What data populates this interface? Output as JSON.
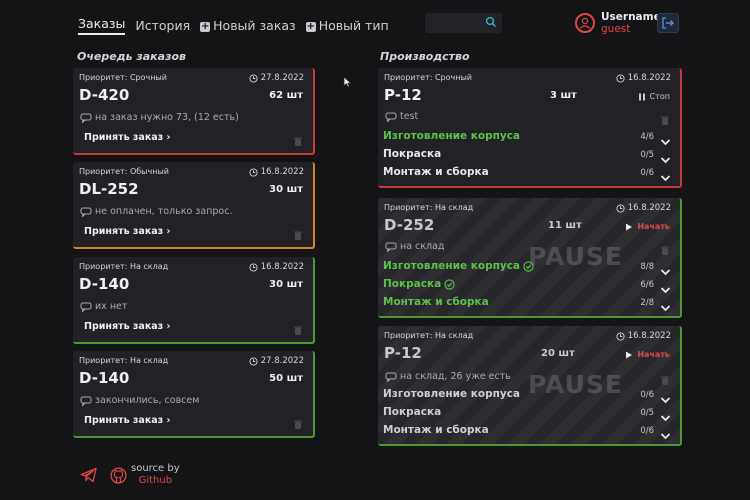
{
  "nav": {
    "tabs": [
      {
        "label": "Заказы"
      },
      {
        "label": "История"
      },
      {
        "label": "Новый заказ"
      },
      {
        "label": "Новый тип"
      }
    ]
  },
  "search": {
    "value": ""
  },
  "user": {
    "name": "Username",
    "role": "guest"
  },
  "queue": {
    "title": "Очередь заказов",
    "accept_label": "Принять заказ",
    "orders": [
      {
        "priority": "Приоритет: Срочный",
        "date": "27.8.2022",
        "code": "D-420",
        "qty": "62 шт",
        "note": "на заказ нужно 73, (12 есть)",
        "status": "red"
      },
      {
        "priority": "Приоритет: Обычный",
        "date": "16.8.2022",
        "code": "DL-252",
        "qty": "30 шт",
        "note": "не оплачен, только запрос.",
        "status": "orange"
      },
      {
        "priority": "Приоритет: На склад",
        "date": "16.8.2022",
        "code": "D-140",
        "qty": "30 шт",
        "note": "их нет",
        "status": "green"
      },
      {
        "priority": "Приоритет: На склад",
        "date": "27.8.2022",
        "code": "D-140",
        "qty": "50 шт",
        "note": "закончились, совсем",
        "status": "green"
      }
    ]
  },
  "production": {
    "title": "Производство",
    "pause_label": "PAUSE",
    "items": [
      {
        "priority": "Приоритет: Срочный",
        "date": "16.8.2022",
        "code": "P-12",
        "qty": "3 шт",
        "action": "Стоп",
        "note": "test",
        "paused": false,
        "status": "red",
        "stages": [
          {
            "name": "Изготовление корпуса",
            "count": "4/6",
            "done": true
          },
          {
            "name": "Покраска",
            "count": "0/5",
            "done": false
          },
          {
            "name": "Монтаж и сборка",
            "count": "0/6",
            "done": false
          }
        ]
      },
      {
        "priority": "Приоритет: На склад",
        "date": "16.8.2022",
        "code": "D-252",
        "qty": "11 шт",
        "action": "Начать",
        "note": "на склад",
        "paused": true,
        "status": "green",
        "stages": [
          {
            "name": "Изготовление корпуса",
            "count": "8/8",
            "done": true
          },
          {
            "name": "Покраска",
            "count": "6/6",
            "done": true
          },
          {
            "name": "Монтаж и сборка",
            "count": "2/8",
            "done": true
          }
        ]
      },
      {
        "priority": "Приоритет: На склад",
        "date": "16.8.2022",
        "code": "P-12",
        "qty": "20 шт",
        "action": "Начать",
        "note": "на склад, 26 уже есть",
        "paused": true,
        "status": "green",
        "stages": [
          {
            "name": "Изготовление корпуса",
            "count": "0/6",
            "done": false
          },
          {
            "name": "Покраска",
            "count": "0/5",
            "done": false
          },
          {
            "name": "Монтаж и сборка",
            "count": "0/6",
            "done": false
          }
        ]
      }
    ]
  },
  "footer": {
    "source_label": "source by",
    "link_label": "Github"
  },
  "colors": {
    "accent": "#e04848",
    "red": "#c53a3a",
    "orange": "#d3861c",
    "green": "#4b9a34",
    "done_text": "#5cc24a"
  }
}
